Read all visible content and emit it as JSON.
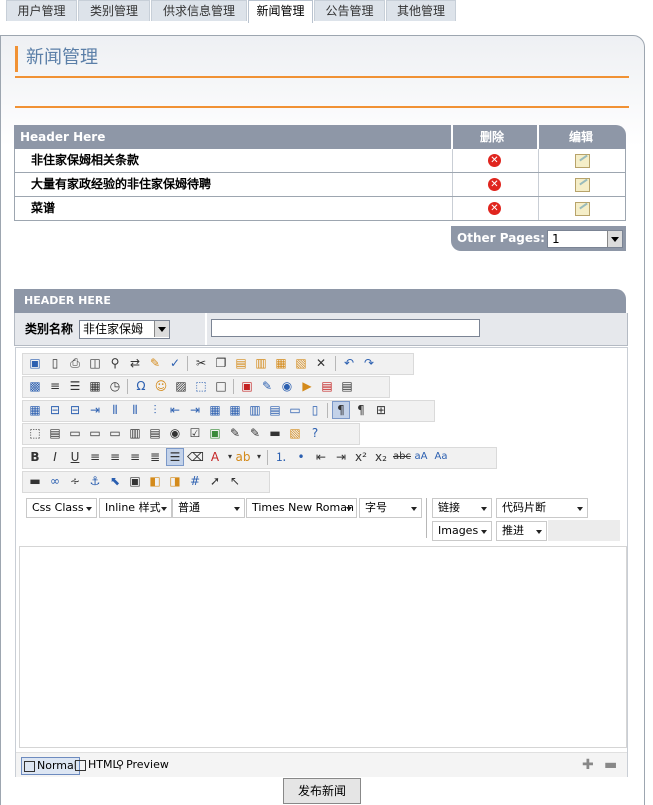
{
  "tabs": [
    {
      "label": "用户管理"
    },
    {
      "label": "类别管理"
    },
    {
      "label": "供求信息管理"
    },
    {
      "label": "新闻管理"
    },
    {
      "label": "公告管理"
    },
    {
      "label": "其他管理"
    }
  ],
  "active_tab": "新闻管理",
  "page_title": "新闻管理",
  "news_table": {
    "headers": {
      "title": "Header Here",
      "delete": "删除",
      "edit": "编辑"
    },
    "rows": [
      {
        "title": "非住家保姆相关条款"
      },
      {
        "title": "大量有家政经验的非住家保姆待聘"
      },
      {
        "title": "菜谱"
      }
    ]
  },
  "pager": {
    "label": "Other Pages:",
    "selected": "1"
  },
  "form": {
    "header": "HEADER HERE",
    "category_label": "类别名称",
    "category_selected": "非住家保姆",
    "name_value": ""
  },
  "editor": {
    "dropdowns": {
      "css_class": "Css Class",
      "inline_style": "Inline 样式",
      "paragraph": "普通",
      "font": "Times New Roman",
      "font_size": "字号",
      "link": "链接",
      "snippet": "代码片断",
      "images": "Images",
      "indent": "推进"
    },
    "modes": {
      "normal": "Normal",
      "html": "HTML",
      "preview": "Preview"
    }
  },
  "publish_button": "发布新闻"
}
